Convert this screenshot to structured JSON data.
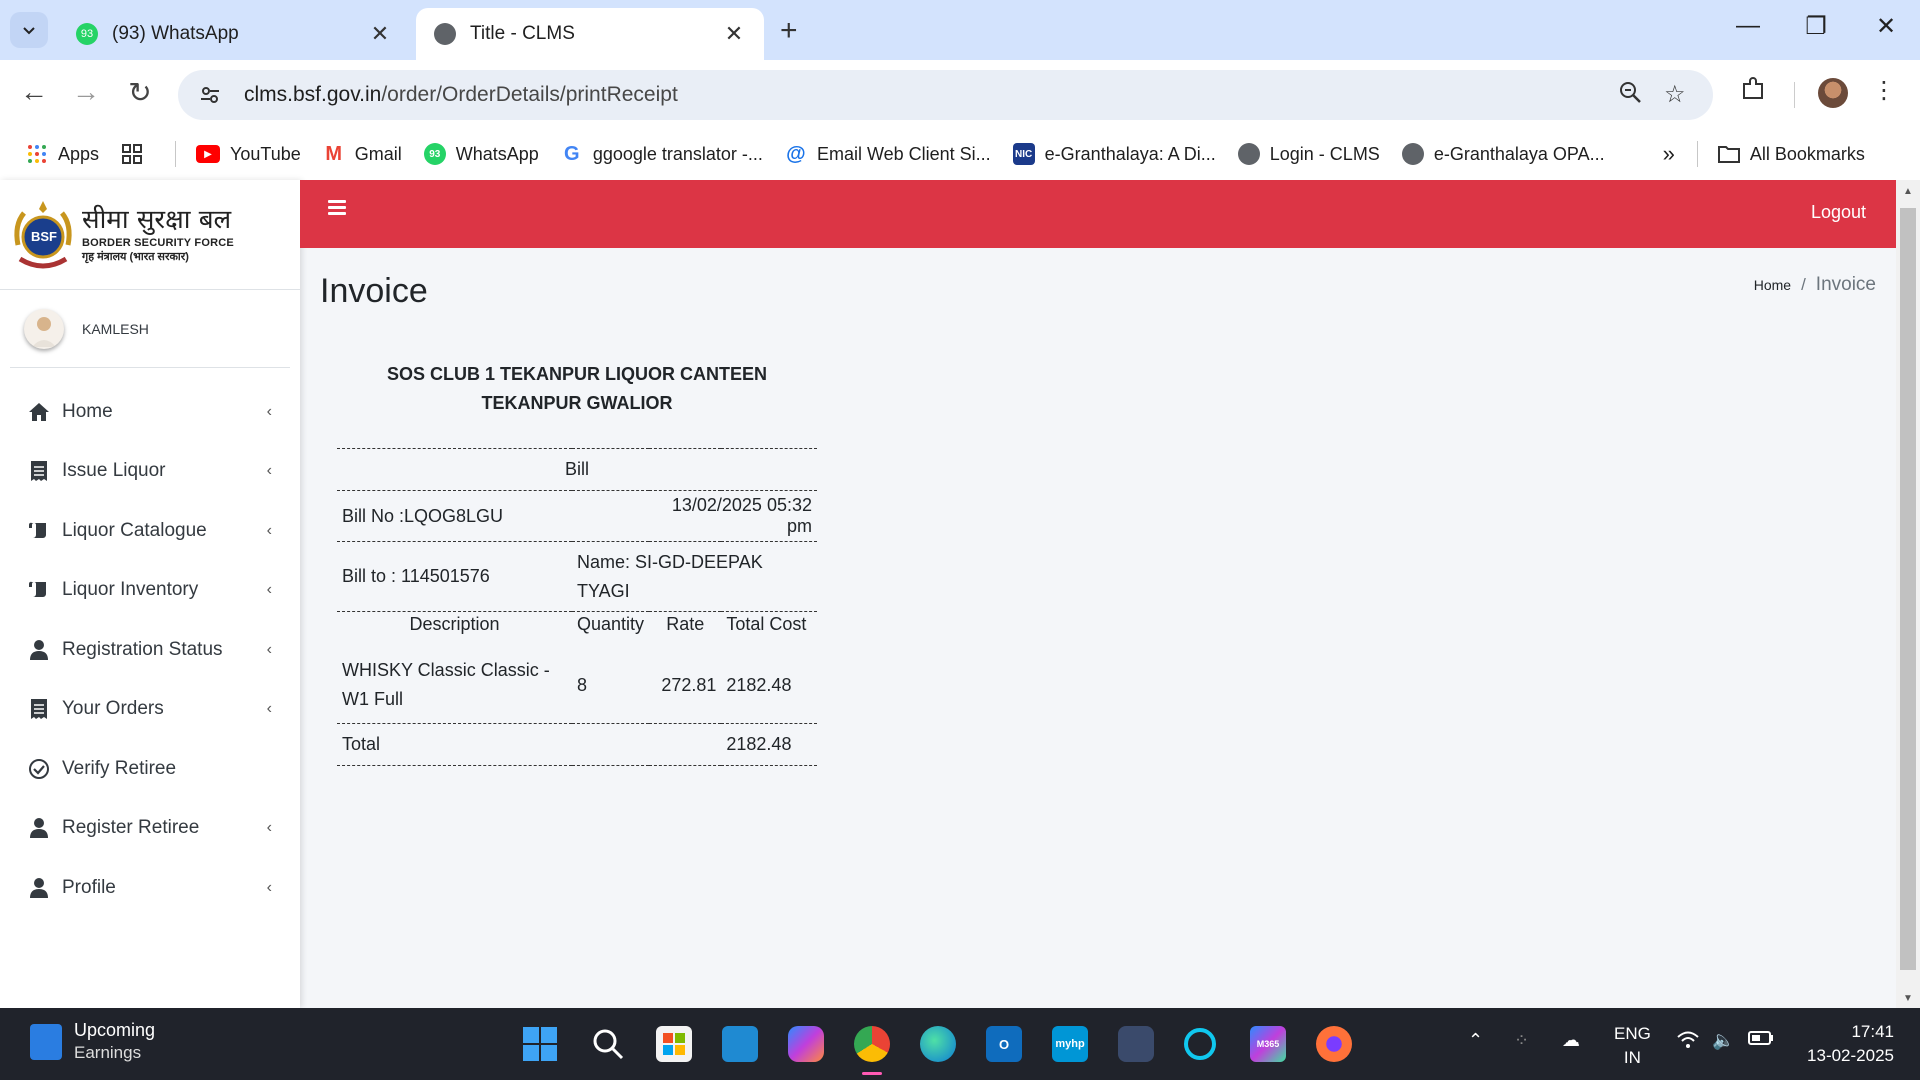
{
  "browser": {
    "tabs": [
      {
        "title": "(93) WhatsApp",
        "badge": "93",
        "active": false
      },
      {
        "title": "Title - CLMS",
        "active": true
      }
    ],
    "url_domain": "clms.bsf.gov.in",
    "url_path": "/order/OrderDetails/printReceipt",
    "bookmarks": [
      {
        "label": "Apps",
        "icon": "apps-grid-icon"
      },
      {
        "label": "YouTube",
        "icon": "youtube-icon"
      },
      {
        "label": "Gmail",
        "icon": "gmail-icon"
      },
      {
        "label": "WhatsApp",
        "icon": "whatsapp-icon"
      },
      {
        "label": "ggoogle translator -...",
        "icon": "google-icon"
      },
      {
        "label": "Email Web Client Si...",
        "icon": "email-at-icon"
      },
      {
        "label": "e-Granthalaya: A Di...",
        "icon": "nic-icon"
      },
      {
        "label": "Login - CLMS",
        "icon": "globe-icon"
      },
      {
        "label": "e-Granthalaya OPA...",
        "icon": "globe-icon"
      }
    ],
    "all_bookmarks": "All Bookmarks"
  },
  "sidebar": {
    "brand_hindi": "सीमा सुरक्षा बल",
    "brand_english": "BORDER SECURITY FORCE",
    "brand_sub": "गृह मंत्रालय (भारत सरकार)",
    "emblem_text": "BSF",
    "user_name": "KAMLESH",
    "menu": [
      {
        "label": "Home",
        "icon": "home-icon",
        "has_chevron": true
      },
      {
        "label": "Issue Liquor",
        "icon": "receipt-icon",
        "has_chevron": true
      },
      {
        "label": "Liquor Catalogue",
        "icon": "scroll-icon",
        "has_chevron": true
      },
      {
        "label": "Liquor Inventory",
        "icon": "scroll-icon",
        "has_chevron": true
      },
      {
        "label": "Registration Status",
        "icon": "user-icon",
        "has_chevron": true
      },
      {
        "label": "Your Orders",
        "icon": "receipt-icon",
        "has_chevron": true
      },
      {
        "label": "Verify Retiree",
        "icon": "check-circle-icon",
        "has_chevron": false
      },
      {
        "label": "Register Retiree",
        "icon": "user-icon",
        "has_chevron": true
      },
      {
        "label": "Profile",
        "icon": "user-icon",
        "has_chevron": true
      }
    ]
  },
  "header": {
    "logout": "Logout",
    "page_title": "Invoice",
    "breadcrumb_home": "Home",
    "breadcrumb_sep": "/",
    "breadcrumb_current": "Invoice"
  },
  "receipt": {
    "line1": "SOS CLUB 1 TEKANPUR LIQUOR CANTEEN",
    "line2": "TEKANPUR GWALIOR",
    "bill_heading": "Bill",
    "bill_no": "Bill No :LQOG8LGU",
    "bill_datetime": "13/02/2025 05:32 pm",
    "bill_to": "Bill to : 114501576",
    "bill_name": "Name: SI-GD-DEEPAK TYAGI",
    "columns": [
      "Description",
      "Quantity",
      "Rate",
      "Total Cost"
    ],
    "items": [
      {
        "description": "WHISKY Classic Classic - W1 Full",
        "quantity": "8",
        "rate": "272.81",
        "total": "2182.48"
      }
    ],
    "total_label": "Total",
    "total_value": "2182.48"
  },
  "taskbar": {
    "weather_title": "Upcoming",
    "weather_sub": "Earnings",
    "lang_line1": "ENG",
    "lang_line2": "IN",
    "time": "17:41",
    "date": "13-02-2025"
  },
  "colors": {
    "header_red": "#dc3545",
    "tabstrip": "#d3e3fd",
    "taskbar": "#20232b"
  }
}
